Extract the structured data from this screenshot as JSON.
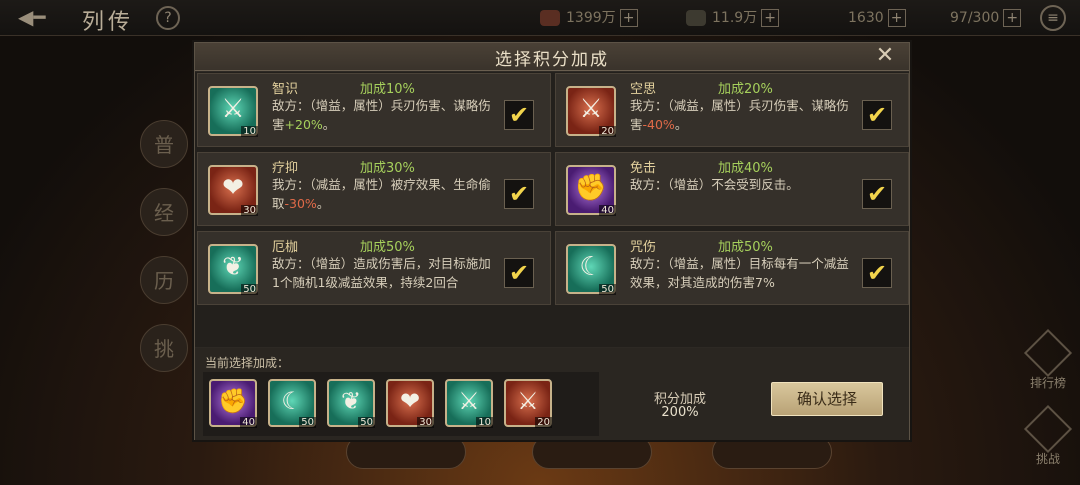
{
  "topbar": {
    "back_icon": "back-arrow-icon",
    "title": "列传",
    "help_symbol": "?",
    "resources": [
      {
        "value": "1399万"
      },
      {
        "value": "11.9万"
      },
      {
        "value": "1630"
      },
      {
        "value": "97/300"
      }
    ],
    "plus_symbol": "+",
    "menu_symbol": "≡"
  },
  "side_tabs": [
    "普",
    "经",
    "历",
    "挑"
  ],
  "right_buttons": [
    {
      "label": "排行榜"
    },
    {
      "label": "挑战"
    }
  ],
  "dialog": {
    "title": "选择积分加成",
    "close_symbol": "✕",
    "check_symbol": "✔",
    "cards": [
      {
        "name": "智识",
        "bonus": "加成10%",
        "desc_a": "敌方：（增益，属性）兵刃伤害、谋略伤害",
        "desc_b": "+20%",
        "desc_c": "。",
        "level": "10",
        "color": "#176e59",
        "icon": "sword-icon",
        "glyph": "⚔",
        "checked": true
      },
      {
        "name": "空思",
        "bonus": "加成20%",
        "desc_a": "我方：（减益，属性）兵刃伤害、谋略伤害",
        "desc_b": "-40%",
        "desc_c": "。",
        "level": "20",
        "color": "#7a2415",
        "icon": "sword-icon",
        "glyph": "⚔",
        "checked": true
      },
      {
        "name": "疗抑",
        "bonus": "加成30%",
        "desc_a": "我方：（减益，属性）被疗效果、生命偷取",
        "desc_b": "-30%",
        "desc_c": "。",
        "level": "30",
        "color": "#7a2415",
        "icon": "hearts-icon",
        "glyph": "❤",
        "checked": true
      },
      {
        "name": "免击",
        "bonus": "加成40%",
        "desc_a": "敌方：（增益）不会受到反击。",
        "desc_b": "",
        "desc_c": "",
        "level": "40",
        "color": "#4a1c72",
        "icon": "fist-icon",
        "glyph": "✊",
        "checked": true
      },
      {
        "name": "厄枷",
        "bonus": "加成50%",
        "desc_a": "敌方：（增益）造成伤害后，对目标施加1个随机1级减益效果，持续2回合",
        "desc_b": "",
        "desc_c": "",
        "level": "50",
        "color": "#176e59",
        "icon": "fan-icon",
        "glyph": "❦",
        "checked": true
      },
      {
        "name": "咒伤",
        "bonus": "加成50%",
        "desc_a": "敌方：（增益，属性）目标每有一个减益效果，对其造成的伤害7%",
        "desc_b": "",
        "desc_c": "",
        "level": "50",
        "color": "#176e59",
        "icon": "claw-icon",
        "glyph": "☾",
        "checked": true
      }
    ],
    "current_label": "当前选择加成：",
    "current": [
      {
        "level": "40",
        "icon": "fist-icon",
        "glyph": "✊",
        "color": "#4a1c72"
      },
      {
        "level": "50",
        "icon": "claw-icon",
        "glyph": "☾",
        "color": "#176e59"
      },
      {
        "level": "50",
        "icon": "fan-icon",
        "glyph": "❦",
        "color": "#176e59"
      },
      {
        "level": "30",
        "icon": "hearts-icon",
        "glyph": "❤",
        "color": "#7a2415"
      },
      {
        "level": "10",
        "icon": "sword-icon",
        "glyph": "⚔",
        "color": "#176e59"
      },
      {
        "level": "20",
        "icon": "sword-icon",
        "glyph": "⚔",
        "color": "#7a2415"
      }
    ],
    "total_label": "积分加成",
    "total_value": "200%",
    "confirm_label": "确认选择"
  }
}
